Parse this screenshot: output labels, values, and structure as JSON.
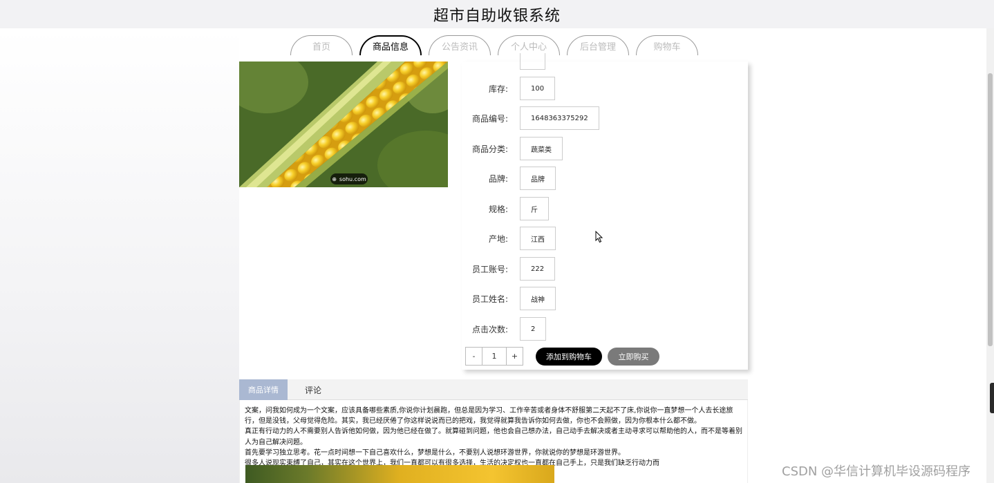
{
  "header": {
    "title": "超市自助收银系统"
  },
  "nav": {
    "tabs": [
      {
        "label": "首页",
        "active": false
      },
      {
        "label": "商品信息",
        "active": true
      },
      {
        "label": "公告资讯",
        "active": false
      },
      {
        "label": "个人中心",
        "active": false
      },
      {
        "label": "后台管理",
        "active": false
      },
      {
        "label": "购物车",
        "active": false
      }
    ]
  },
  "product": {
    "image_badge": "sohu.com",
    "fields": [
      {
        "label": "库存:",
        "value": "100"
      },
      {
        "label": "商品编号:",
        "value": "1648363375292"
      },
      {
        "label": "商品分类:",
        "value": "蔬菜类"
      },
      {
        "label": "品牌:",
        "value": "品牌"
      },
      {
        "label": "规格:",
        "value": "斤"
      },
      {
        "label": "产地:",
        "value": "江西"
      },
      {
        "label": "员工账号:",
        "value": "222"
      },
      {
        "label": "员工姓名:",
        "value": "战神"
      },
      {
        "label": "点击次数:",
        "value": "2"
      }
    ],
    "quantity": {
      "minus": "-",
      "value": "1",
      "plus": "+"
    },
    "add_to_cart_label": "添加到购物车",
    "buy_now_label": "立即购买"
  },
  "detail": {
    "tabs": [
      {
        "label": "商品详情",
        "active": true
      },
      {
        "label": "评论",
        "active": false
      }
    ],
    "paragraphs": [
      "文案，问我如何成为一个文案，应该具备哪些素质,你说你计划晨跑，但总是因为学习、工作辛苦或者身体不舒服第二天起不了床,你说你一直梦想一个人去长途旅行，但是没钱，父母觉得危险。其实，我已经厌倦了你这样说说而已的把戏，我觉得就算我告诉你如何去做，你也不会照做，因为你根本什么都不做。",
      "真正有行动力的人不需要别人告诉他如何做，因为他已经在做了。就算碰到问题，他也会自己想办法，自己动手去解决或者主动寻求可以帮助他的人，而不是等着别人为自己解决问题。",
      "首先要学习独立思考。花一点时间想一下自己喜欢什么，梦想是什么，不要别人说想环游世界，你就说你的梦想是环游世界。",
      "很多人说现实束缚了自己，其实在这个世界上，我们一直都可以有很多选择，生活的决定权也一直都在自己手上，只是我们缺乏行动力而"
    ]
  },
  "watermark": {
    "text": "CSDN @华信计算机毕设源码程序"
  },
  "colors": {
    "header_bg": "#f2f2f4",
    "cart_button": "#000000",
    "buy_button": "#7a7a7a",
    "detail_tab_active": "#aab8d2"
  }
}
